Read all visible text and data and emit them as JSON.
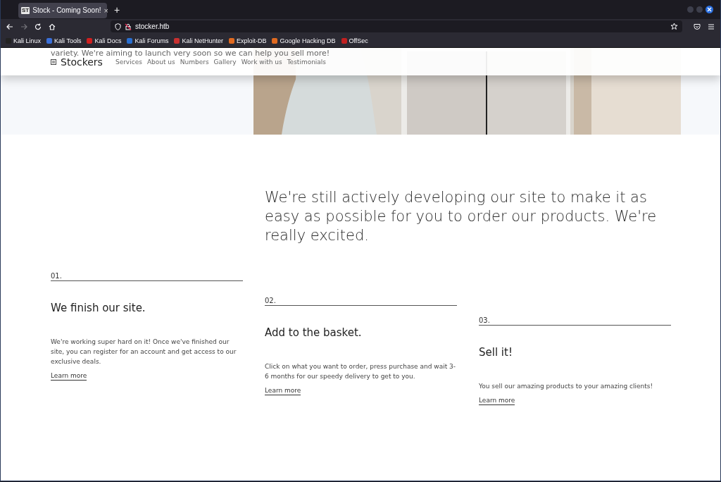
{
  "browser": {
    "tab": {
      "favicon": "ST",
      "title": "Stock - Coming Soon!",
      "close": "×",
      "selected": true
    },
    "new_tab": "+",
    "forward": {
      "disabled": true
    },
    "url": "stocker.htb",
    "bookmarks": [
      {
        "label": "Kali Linux"
      },
      {
        "label": "Kali Tools"
      },
      {
        "label": "Kali Docs"
      },
      {
        "label": "Kali Forums"
      },
      {
        "label": "Kali NetHunter"
      },
      {
        "label": "Exploit-DB"
      },
      {
        "label": "Google Hacking DB"
      },
      {
        "label": "OffSec"
      }
    ]
  },
  "hero": {
    "text": "variety. We're aiming to launch very soon so we can help you sell more!"
  },
  "header": {
    "brand": "Stockers",
    "nav": [
      "Services",
      "About us",
      "Numbers",
      "Gallery",
      "Work with us",
      "Testimonials"
    ]
  },
  "intro": "We're still actively developing our site to make it as easy as possible for you to order our products. We're really excited.",
  "steps": [
    {
      "number": "01.",
      "title": "We finish our site.",
      "text": "We're working super hard on it! Once we've finished our site, you can register for an account and get access to our exclusive deals.",
      "link": "Learn more"
    },
    {
      "number": "02.",
      "title": "Add to the basket.",
      "text": "Click on what you want to order, press purchase and wait 3-6 months for our speedy delivery to get to you.",
      "link": "Learn more"
    },
    {
      "number": "03.",
      "title": "Sell it!",
      "text": "You sell our amazing products to your amazing clients!",
      "link": "Learn more"
    }
  ]
}
